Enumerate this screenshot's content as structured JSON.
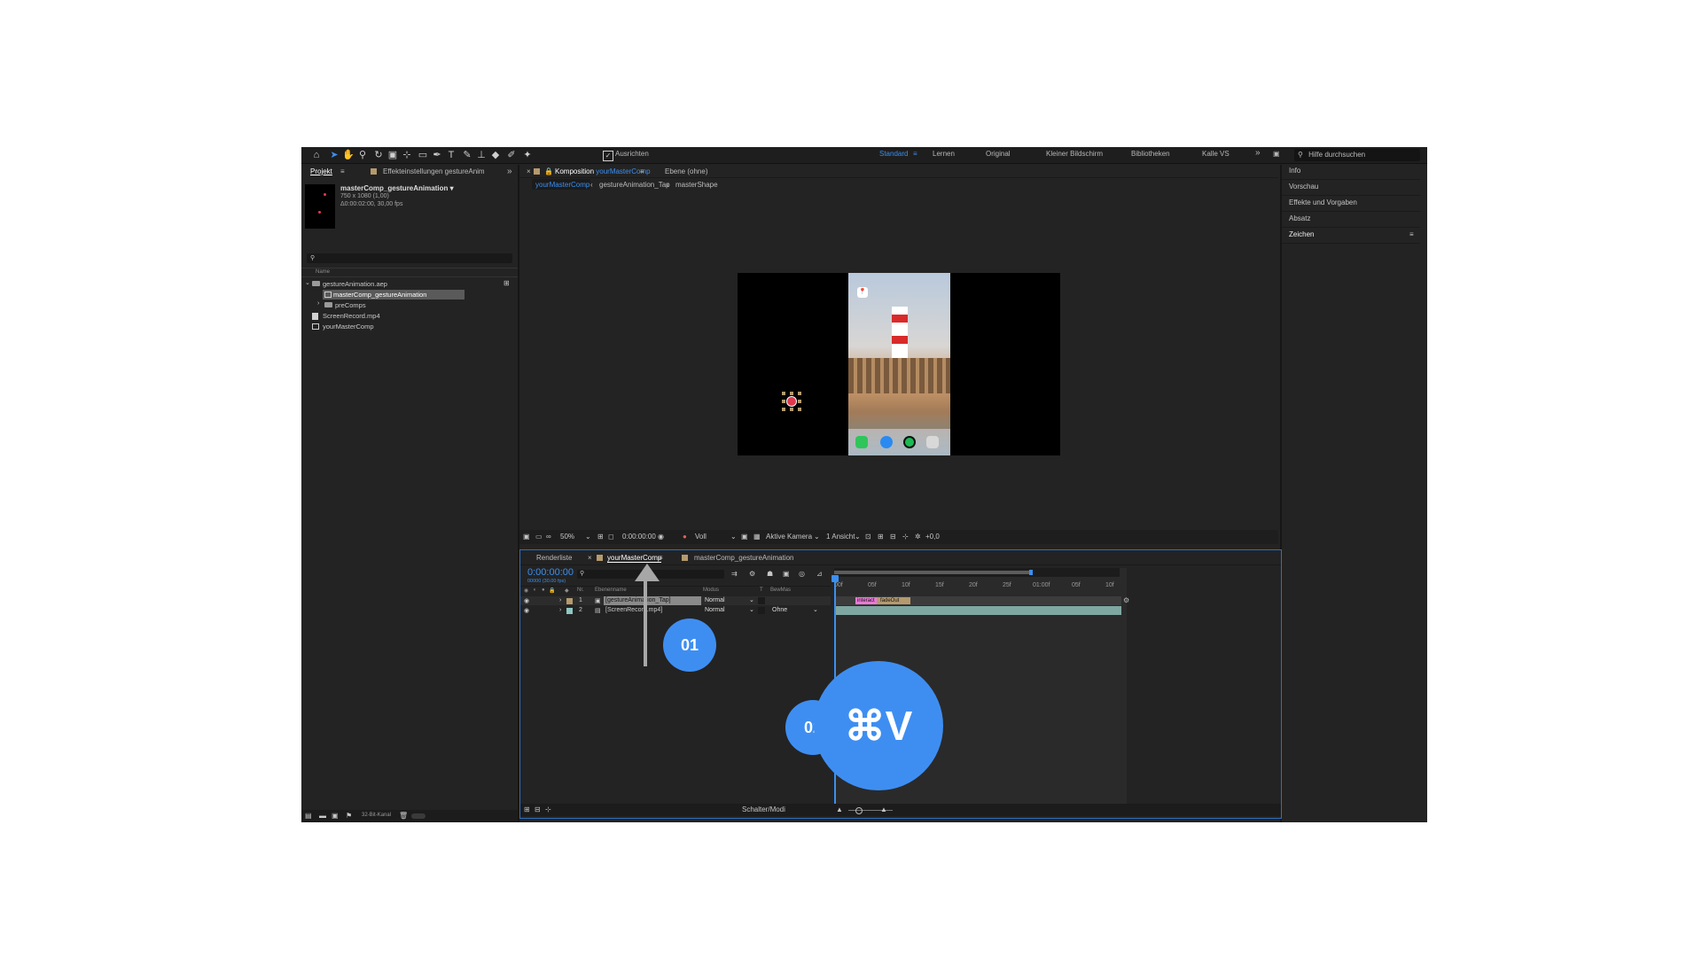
{
  "toolbar": {
    "ausrichten_label": "Ausrichten",
    "workspaces": [
      "Standard",
      "Lernen",
      "Original",
      "Kleiner Bildschirm",
      "Bibliotheken",
      "Kalle VS"
    ],
    "help_search_placeholder": "Hilfe durchsuchen"
  },
  "project_panel": {
    "tab_project": "Projekt",
    "tab_effects": "Effekteinstellungen gestureAnim",
    "comp_name": "masterComp_gestureAnimation ▾",
    "comp_dims": "750 x 1080 (1,00)",
    "comp_duration": "Δ0:00:02:00, 30,00 fps",
    "column_name": "Name",
    "items": [
      {
        "label": "gestureAnimation.aep",
        "type": "folder"
      },
      {
        "label": "masterComp_gestureAnimation",
        "type": "comp",
        "selected": true
      },
      {
        "label": "preComps",
        "type": "folder"
      },
      {
        "label": "ScreenRecord.mp4",
        "type": "footage"
      },
      {
        "label": "yourMasterComp",
        "type": "comp"
      }
    ],
    "bit_depth": "32-Bit-Kanal"
  },
  "comp_panel": {
    "tab_prefix": "Komposition ",
    "tab_comp_name": "yourMasterComp",
    "tab_layer": "Ebene (ohne)",
    "breadcrumbs": [
      "yourMasterComp",
      "gestureAnimation_Tap",
      "masterShape"
    ]
  },
  "viewer_bar": {
    "zoom": "50%",
    "timecode": "0:00:00:00",
    "quality": "Voll",
    "camera": "Aktive Kamera",
    "views": "1 Ansicht",
    "exposure": "+0,0"
  },
  "right_panel": {
    "items": [
      "Info",
      "Vorschau",
      "Effekte und Vorgaben",
      "Absatz",
      "Zeichen"
    ]
  },
  "timeline": {
    "tab_render": "Renderliste",
    "tab_comp": "yourMasterComp",
    "tab_master": "masterComp_gestureAnimation",
    "timecode": "0:00:00:00",
    "frames": "00000 (30.00 fps)",
    "headers": {
      "nr": "Nr.",
      "name": "Ebenenname",
      "mode": "Modus",
      "t": "T",
      "bewmas": "BewMas"
    },
    "layers": [
      {
        "nr": "1",
        "name": "[gestureAnimation_Tap]",
        "mode": "Normal",
        "bewmas": "",
        "color": "#b59a6e"
      },
      {
        "nr": "2",
        "name": "[ScreenRecord.mp4]",
        "mode": "Normal",
        "bewmas": "Ohne",
        "color": "#8fc7c2"
      }
    ],
    "ruler": [
      "00f",
      "05f",
      "10f",
      "15f",
      "20f",
      "25f",
      "01:00f",
      "05f",
      "10f"
    ],
    "markers": [
      "interact",
      "fadeOut"
    ],
    "footer": "Schalter/Modi"
  },
  "annotations": {
    "step1": "01",
    "step2": "02",
    "shortcut": "⌘V"
  },
  "colors": {
    "accent": "#3b8ff0",
    "badge": "#3e8ef2",
    "panel": "#232323",
    "toolbar": "#1e1e1e"
  }
}
